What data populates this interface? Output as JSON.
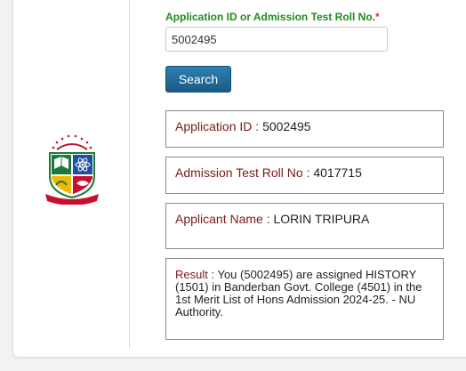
{
  "form": {
    "field_label": "Application ID or Admission Test Roll No.",
    "required_mark": "*",
    "roll_value": "5002495",
    "search_label": "Search"
  },
  "results": {
    "application_id": {
      "label": "Application ID :",
      "value": "5002495"
    },
    "roll_no": {
      "label": "Admission Test Roll No :",
      "value": "4017715"
    },
    "applicant_name": {
      "label": "Applicant Name :",
      "value": "LORIN TRIPURA"
    },
    "result": {
      "label": "Result :",
      "value": "You (5002495) are assigned HISTORY (1501) in Banderban Govt. College (4501) in the 1st Merit List of Hons Admission 2024-25. - NU Authority."
    }
  },
  "logo": {
    "icon": "nu-logo-icon",
    "colors": [
      "#1b7a3a",
      "#c8102e",
      "#f2b705",
      "#1e4fa0"
    ]
  }
}
